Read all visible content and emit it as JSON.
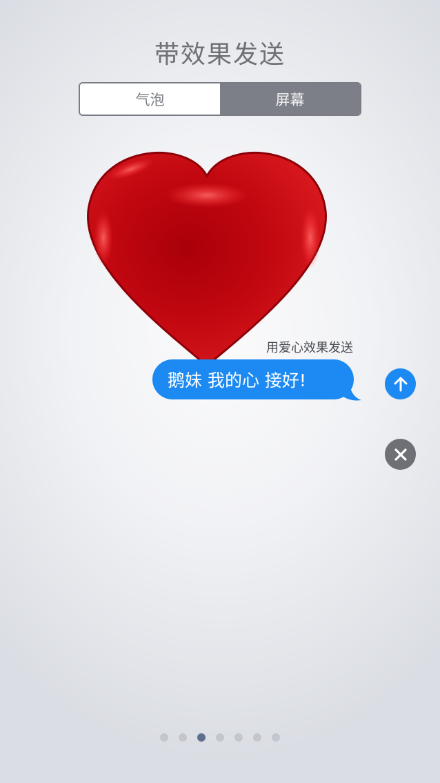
{
  "header": {
    "title": "带效果发送"
  },
  "tabs": [
    {
      "label": "气泡",
      "selected": false
    },
    {
      "label": "屏幕",
      "selected": true
    }
  ],
  "effect": {
    "name": "heart",
    "label": "用爱心效果发送"
  },
  "message": {
    "text": "鹅妹 我的心 接好!"
  },
  "actions": {
    "send_icon": "arrow-up-icon",
    "close_icon": "close-icon"
  },
  "pagination": {
    "total": 7,
    "current": 3
  },
  "colors": {
    "bubble": "#1c8af2",
    "heart": "#c40812",
    "active_tab": "#7c7f87",
    "close_button": "#6f7076"
  }
}
